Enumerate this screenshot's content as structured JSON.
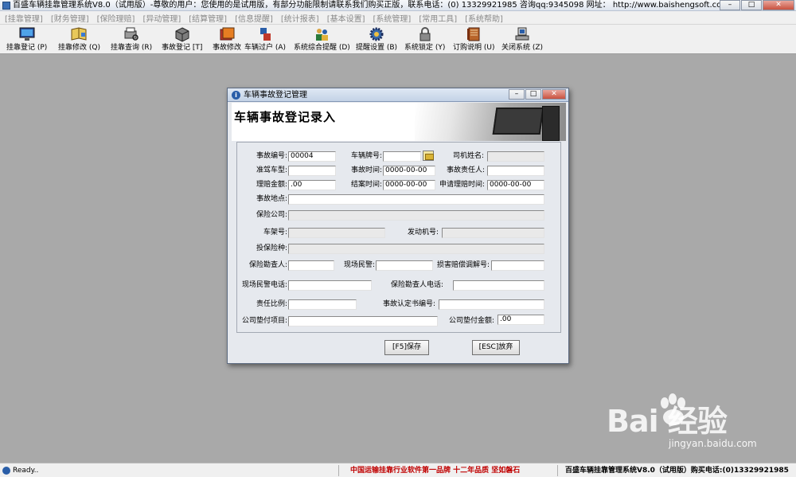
{
  "window": {
    "title": "百盛车辆挂靠管理系统V8.0（试用版）-尊敬的用户：您使用的是试用版，有部分功能限制请联系我们购买正版，联系电话：(0) 13329921985  咨询qq:9345098   网址：  http://www.baishengsoft.com"
  },
  "menu": [
    "[挂靠管理]",
    "[财务管理]",
    "[保险理赔]",
    "[异动管理]",
    "[结算管理]",
    "[信息提醒]",
    "[统计报表]",
    "[基本设置]",
    "[系统管理]",
    "[常用工具]",
    "[系统帮助]"
  ],
  "toolbar": [
    {
      "label": "挂靠登记 (P)",
      "icon": "monitor-icon"
    },
    {
      "label": "挂靠修改 (Q)",
      "icon": "book-icon"
    },
    {
      "label": "挂靠查询 (R)",
      "icon": "print-search-icon"
    },
    {
      "label": "事故登记 [T]",
      "icon": "cube-icon"
    },
    {
      "label": "事故修改",
      "icon": "folders-icon"
    },
    {
      "label": "车辆过户 (A)",
      "icon": "transfer-icon"
    },
    {
      "label": "系统综合提醒 (D)",
      "icon": "people-icon"
    },
    {
      "label": "提醒设置 (B)",
      "icon": "gear-icon"
    },
    {
      "label": "系统锁定 (Y)",
      "icon": "lock-icon"
    },
    {
      "label": "订购说明 (U)",
      "icon": "notebook-icon"
    },
    {
      "label": "关闭系统 (Z)",
      "icon": "computer-icon"
    }
  ],
  "dialog": {
    "title": "车辆事故登记管理",
    "heading": "车辆事故登记录入",
    "fields": {
      "accident_no": {
        "label": "事故编号:",
        "value": "00004"
      },
      "plate_no": {
        "label": "车辆牌号:",
        "value": ""
      },
      "driver_name": {
        "label": "司机姓名:",
        "value": ""
      },
      "license_type": {
        "label": "准驾车型:",
        "value": ""
      },
      "accident_time": {
        "label": "事故时间:",
        "value": "0000-00-00"
      },
      "responsible_person": {
        "label": "事故责任人:",
        "value": ""
      },
      "claim_amount": {
        "label": "理赔金额:",
        "value": ".00"
      },
      "close_time": {
        "label": "结案时间:",
        "value": "0000-00-00"
      },
      "claim_apply_time": {
        "label": "申请理赔时间:",
        "value": "0000-00-00"
      },
      "accident_location": {
        "label": "事故地点:",
        "value": ""
      },
      "insurance_company": {
        "label": "保险公司:",
        "value": ""
      },
      "frame_no": {
        "label": "车架号:",
        "value": ""
      },
      "engine_no": {
        "label": "发动机号:",
        "value": ""
      },
      "insurance_type": {
        "label": "投保险种:",
        "value": ""
      },
      "insurance_surveyor": {
        "label": "保险勘查人:",
        "value": ""
      },
      "onsite_police": {
        "label": "现场民警:",
        "value": ""
      },
      "damage_mediation_no": {
        "label": "损害赔偿调解号:",
        "value": ""
      },
      "police_phone": {
        "label": "现场民警电话:",
        "value": ""
      },
      "surveyor_phone": {
        "label": "保险勘查人电话:",
        "value": ""
      },
      "liability_ratio": {
        "label": "责任比例:",
        "value": ""
      },
      "accident_cert_no": {
        "label": "事故认定书编号:",
        "value": ""
      },
      "advance_item": {
        "label": "公司垫付项目:",
        "value": ""
      },
      "advance_amount": {
        "label": "公司垫付金额:",
        "value": ".00"
      }
    },
    "buttons": {
      "save": "[F5]保存",
      "cancel": "[ESC]放弃"
    }
  },
  "statusbar": {
    "ready": "Ready..",
    "slogan": "中国运输挂靠行业软件第一品牌    十二年品质 坚如磐石",
    "product": "百盛车辆挂靠管理系统V8.0（试用版）购买电话:(0)13329921985"
  },
  "watermark": {
    "text": "Bai  经验",
    "url": "jingyan.baidu.com"
  }
}
